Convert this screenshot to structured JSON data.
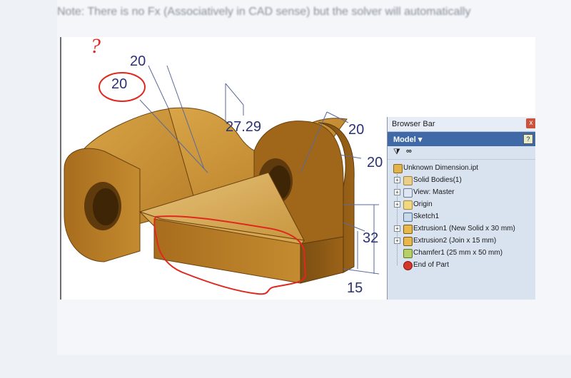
{
  "post": {
    "text": "Note: There is no Fx (Associatively in CAD sense) but the solver will automatically"
  },
  "drawing": {
    "dimensions": {
      "top_left_20": "20",
      "circled_20": "20",
      "middle_27_29": "27.29",
      "right_20_upper": "20",
      "right_20_lower": "20",
      "height_32": "32",
      "height_15": "15"
    },
    "annotations": {
      "question_mark": "?"
    },
    "colors": {
      "part_body": "#c28a2e",
      "part_shadow": "#7a4e12",
      "dimension_ink": "#2b3272",
      "markup_red": "#e0281e"
    }
  },
  "browser_bar": {
    "title": "Browser Bar",
    "close_label": "x",
    "model_label": "Model ▾",
    "help_label": "?",
    "filter_icon": "filter-icon",
    "find_icon": "binoculars-icon",
    "tree": [
      {
        "label": "Unknown Dimension.ipt",
        "icon": "part-icon",
        "expandable": false,
        "level": 0
      },
      {
        "label": "Solid Bodies(1)",
        "icon": "solid-bodies-icon",
        "expandable": true,
        "level": 1
      },
      {
        "label": "View: Master",
        "icon": "view-icon",
        "expandable": true,
        "level": 1
      },
      {
        "label": "Origin",
        "icon": "folder-icon",
        "expandable": true,
        "level": 1
      },
      {
        "label": "Sketch1",
        "icon": "sketch-icon",
        "expandable": false,
        "level": 1
      },
      {
        "label": "Extrusion1 (New Solid x 30 mm)",
        "icon": "extrusion-icon",
        "expandable": true,
        "level": 1
      },
      {
        "label": "Extrusion2 (Join x 15 mm)",
        "icon": "extrusion-icon",
        "expandable": true,
        "level": 1
      },
      {
        "label": "Chamfer1 (25 mm x 50 mm)",
        "icon": "chamfer-icon",
        "expandable": false,
        "level": 1
      },
      {
        "label": "End of Part",
        "icon": "end-of-part-icon",
        "expandable": false,
        "level": 1
      }
    ]
  }
}
